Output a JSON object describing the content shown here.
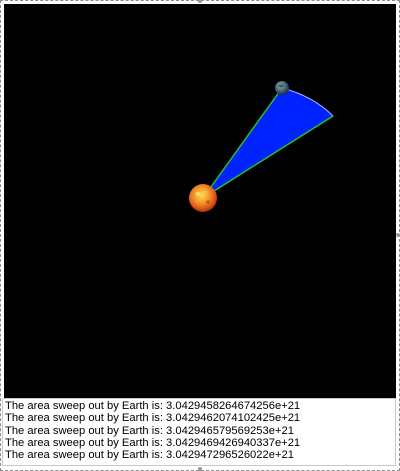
{
  "simulation": {
    "background_color": "#000000",
    "sector_color": "#0022ff",
    "radius_line_color": "#22cc22",
    "sun": {
      "icon": "sun-icon",
      "color_core": "#ffcc33",
      "color_edge": "#e0551a"
    },
    "earth": {
      "icon": "earth-icon",
      "color_core": "#5a7a8c",
      "color_edge": "#1e2e38"
    }
  },
  "console": {
    "lines": [
      "The area sweep out by Earth is: 3.0429458264674256e+21",
      "The area sweep out by Earth is: 3.0429462074102425e+21",
      "The area sweep out by Earth is: 3.042946579569253e+21",
      "The area sweep out by Earth is: 3.0429469426940337e+21",
      "The area sweep out by Earth is: 3.042947296526022e+21"
    ]
  }
}
